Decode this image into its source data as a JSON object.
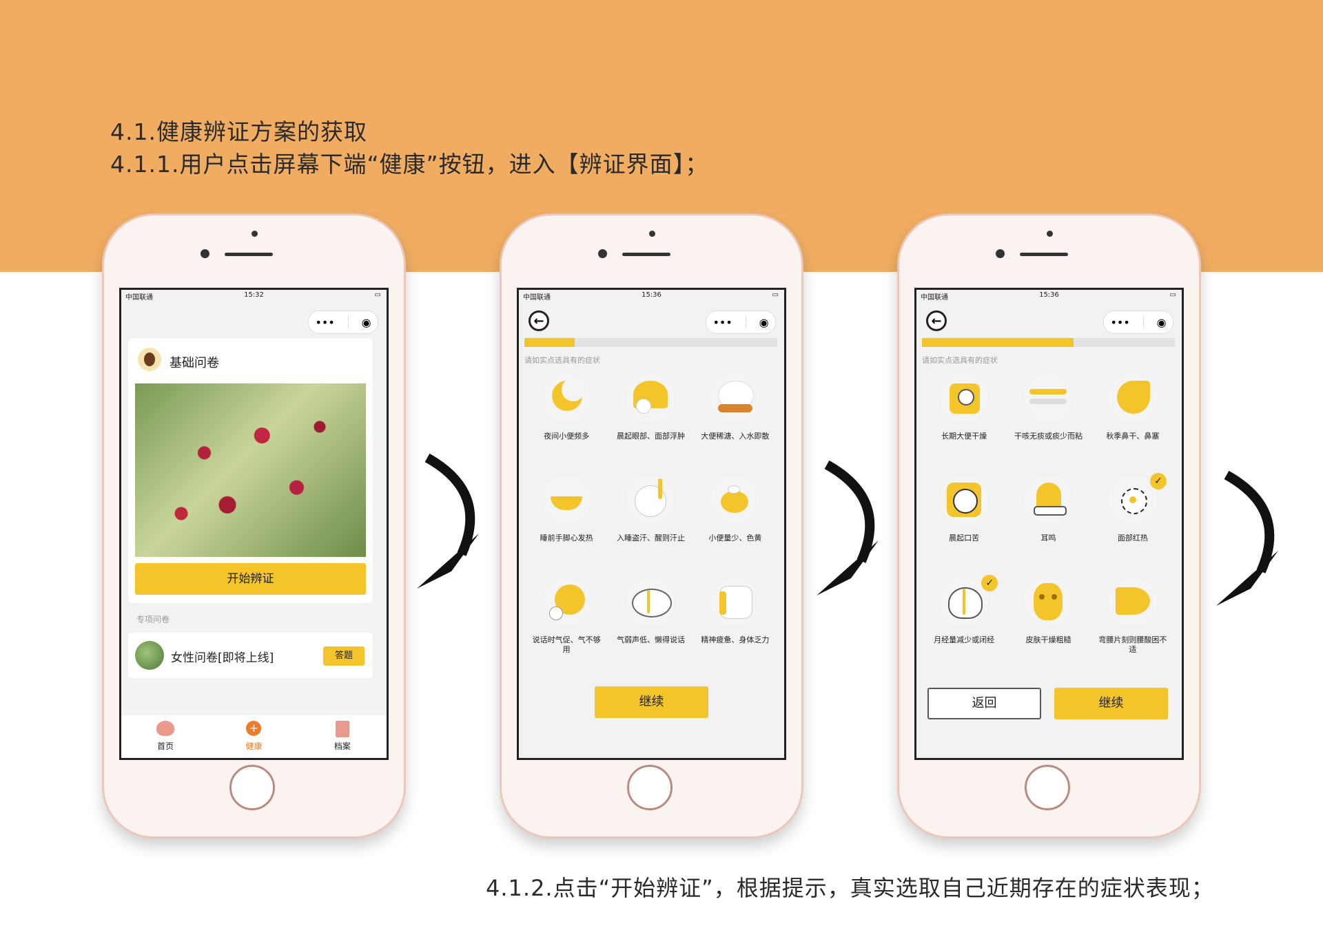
{
  "doc": {
    "heading_1": "4.1.健康辨证方案的获取",
    "heading_2": "4.1.1.用户点击屏幕下端“健康”按钮，进入【辨证界面】；",
    "caption": "4.1.2.点击“开始辨证”，根据提示，真实选取自己近期存在的症状表现；"
  },
  "colors": {
    "accent": "#f3c52b",
    "band": "#f0ad62"
  },
  "phone1": {
    "status": {
      "carrier": "中国联通",
      "time": "15:32"
    },
    "card": {
      "title": "基础问卷",
      "start_button": "开始辨证"
    },
    "section_label": "专项问卷",
    "special": {
      "title": "女性问卷[即将上线]",
      "answer_button": "答题"
    },
    "tabbar": [
      {
        "label": "首页",
        "icon": "heart-home-icon"
      },
      {
        "label": "健康",
        "icon": "plus-health-icon",
        "active": true
      },
      {
        "label": "档案",
        "icon": "file-archive-icon"
      }
    ]
  },
  "phone2": {
    "status": {
      "carrier": "中国联通",
      "time": "15:36"
    },
    "progress": 0.2,
    "hint": "请如实点选具有的症状",
    "symptoms": [
      {
        "label": "夜间小便频多",
        "icon": "moon-icon",
        "checked": false
      },
      {
        "label": "晨起眼部、面部浮肿",
        "icon": "sunrise-face-icon",
        "checked": false
      },
      {
        "label": "大便稀溏、入水即散",
        "icon": "bowl-icon",
        "checked": false
      },
      {
        "label": "睡前手脚心发热",
        "icon": "hand-heat-icon",
        "checked": false
      },
      {
        "label": "入睡盗汗、醒则汗止",
        "icon": "sweat-icon",
        "checked": false
      },
      {
        "label": "小便量少、色黄",
        "icon": "teapot-icon",
        "checked": false
      },
      {
        "label": "说话时气促、气不够用",
        "icon": "breath-icon",
        "checked": false
      },
      {
        "label": "气弱声低、懒得说话",
        "icon": "low-voice-icon",
        "checked": false
      },
      {
        "label": "精神疲惫、身体乏力",
        "icon": "pillow-icon",
        "checked": false
      }
    ],
    "continue_button": "继续"
  },
  "phone3": {
    "status": {
      "carrier": "中国联通",
      "time": "15:36"
    },
    "progress": 0.6,
    "hint": "请如实点选具有的症状",
    "symptoms": [
      {
        "label": "长期大便干燥",
        "icon": "paper-roll-icon",
        "checked": false
      },
      {
        "label": "干咳无痰或痰少而粘",
        "icon": "cough-icon",
        "checked": false
      },
      {
        "label": "秋季鼻干、鼻塞",
        "icon": "nose-icon",
        "checked": false
      },
      {
        "label": "晨起口苦",
        "icon": "drop-icon",
        "checked": false
      },
      {
        "label": "耳鸣",
        "icon": "bell-icon",
        "checked": false
      },
      {
        "label": "面部红热",
        "icon": "sun-icon",
        "checked": true
      },
      {
        "label": "月经量减少或闭经",
        "icon": "broken-heart-icon",
        "checked": true
      },
      {
        "label": "皮肤干燥粗糙",
        "icon": "face-mask-icon",
        "checked": false
      },
      {
        "label": "弯腰片刻则腰酸困不适",
        "icon": "waist-icon",
        "checked": false
      }
    ],
    "back_button": "返回",
    "continue_button": "继续"
  }
}
